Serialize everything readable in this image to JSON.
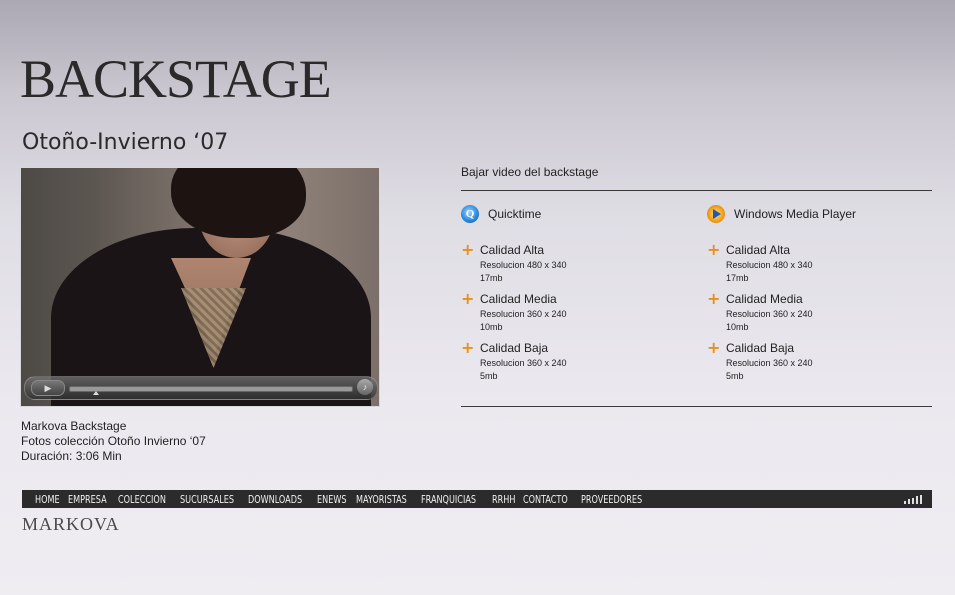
{
  "page": {
    "title": "BACKSTAGE",
    "subtitle": "Otoño-Invierno ‘07"
  },
  "video": {
    "play_icon": "play-icon",
    "volume_icon": "volume-icon"
  },
  "caption": {
    "line1": "Markova Backstage",
    "line2": "Fotos colección Otoño Invierno ‘07",
    "line3": "Duración: 3:06 Min"
  },
  "download": {
    "title": "Bajar video del backstage",
    "columns": [
      {
        "name": "Quicktime",
        "icon": "quicktime-icon",
        "options": [
          {
            "label": "Calidad Alta",
            "resolution": "Resolucion 480 x 340",
            "size": "17mb"
          },
          {
            "label": "Calidad Media",
            "resolution": "Resolucion 360 x 240",
            "size": "10mb"
          },
          {
            "label": "Calidad Baja",
            "resolution": "Resolucion 360 x 240",
            "size": "5mb"
          }
        ]
      },
      {
        "name": "Windows Media Player",
        "icon": "windows-media-player-icon",
        "options": [
          {
            "label": "Calidad Alta",
            "resolution": "Resolucion 480 x 340",
            "size": "17mb"
          },
          {
            "label": "Calidad Media",
            "resolution": "Resolucion 360 x 240",
            "size": "10mb"
          },
          {
            "label": "Calidad Baja",
            "resolution": "Resolucion 360 x 240",
            "size": "5mb"
          }
        ]
      }
    ]
  },
  "nav": {
    "items": [
      "HOME",
      "EMPRESA",
      "COLECCION",
      "SUCURSALES",
      "DOWNLOADS",
      "ENEWS",
      "MAYORISTAS",
      "FRANQUICIAS",
      "RRHH",
      "CONTACTO",
      "PROVEEDORES"
    ],
    "sound_icon": "sound-bars-icon"
  },
  "brand": "MARKOVA",
  "colors": {
    "accent": "#e8901c",
    "nav_bg": "#2b2b2b"
  }
}
